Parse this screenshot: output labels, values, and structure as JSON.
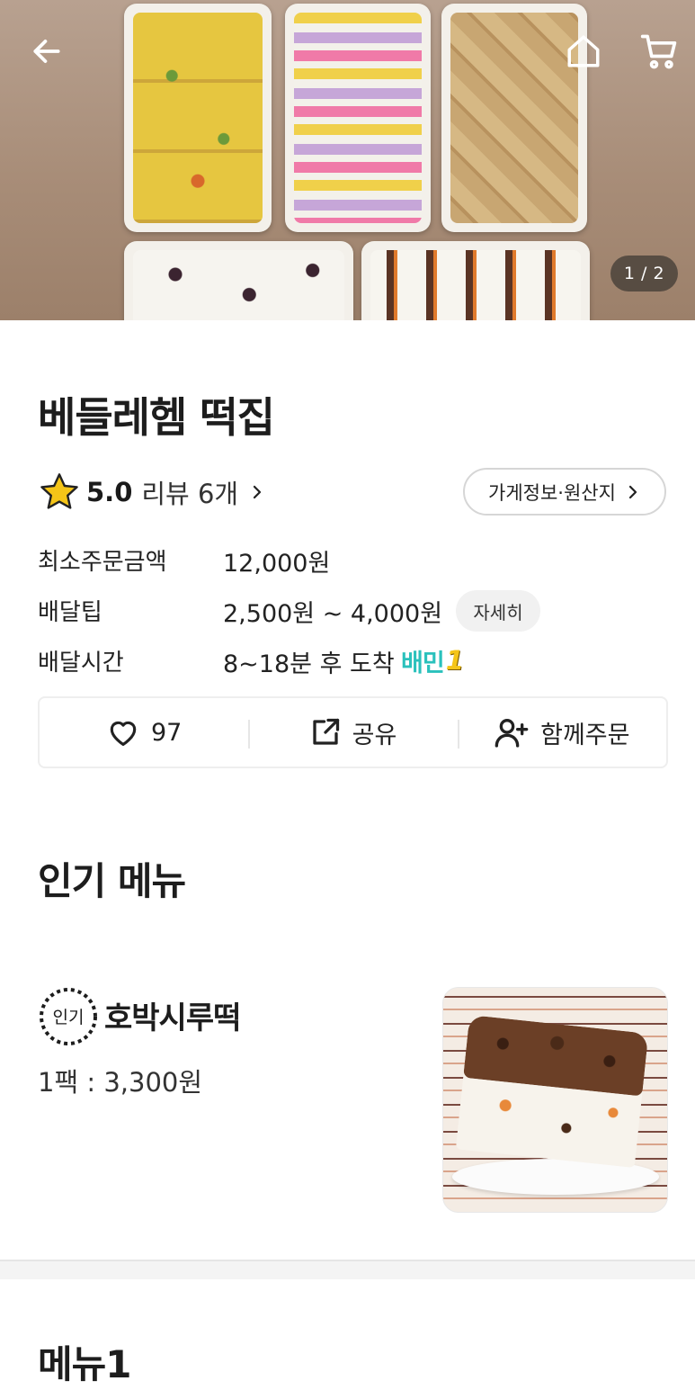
{
  "hero": {
    "page_indicator": "1 / 2",
    "back_icon": "arrow-left-icon",
    "home_icon": "home-icon",
    "cart_icon": "cart-icon"
  },
  "store": {
    "name": "베들레헴 떡집",
    "rating": "5.0",
    "review_label": "리뷰 6개",
    "info_button_label": "가게정보·원산지"
  },
  "info_rows": [
    {
      "label": "최소주문금액",
      "value": "12,000원"
    },
    {
      "label": "배달팁",
      "value": "2,500원 ~ 4,000원",
      "chip": "자세히"
    },
    {
      "label": "배달시간",
      "value": "8~18분 후 도착",
      "badge": "배민",
      "badge_suffix": "1"
    }
  ],
  "actions": {
    "likes": "97",
    "share_label": "공유",
    "group_order_label": "함께주문"
  },
  "popular_section": {
    "title": "인기 메뉴",
    "items": [
      {
        "badge": "인기",
        "name": "호박시루떡",
        "price": "1팩 : 3,300원"
      }
    ]
  },
  "menu1_section": {
    "title": "메뉴1"
  },
  "colors": {
    "accent_mint": "#2ac1bc",
    "text": "#1d1d1d",
    "star": "#f5c518"
  }
}
